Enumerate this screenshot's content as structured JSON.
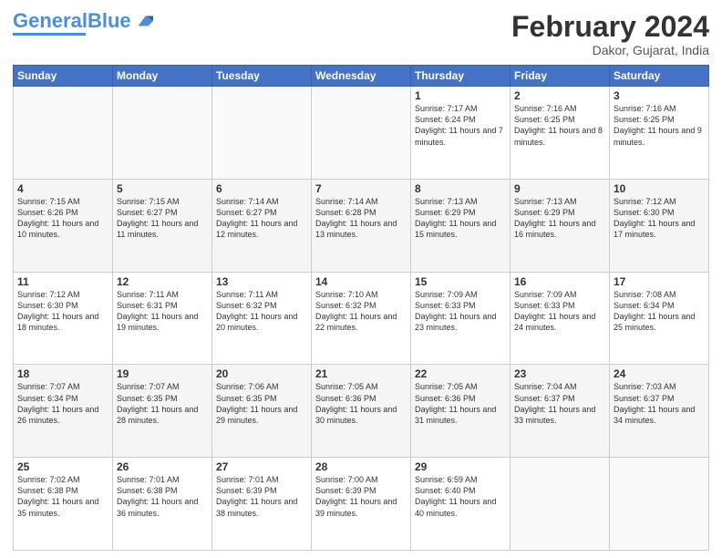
{
  "header": {
    "logo_general": "General",
    "logo_blue": "Blue",
    "month_title": "February 2024",
    "location": "Dakor, Gujarat, India"
  },
  "days_of_week": [
    "Sunday",
    "Monday",
    "Tuesday",
    "Wednesday",
    "Thursday",
    "Friday",
    "Saturday"
  ],
  "weeks": [
    [
      {
        "day": "",
        "sunrise": "",
        "sunset": "",
        "daylight": ""
      },
      {
        "day": "",
        "sunrise": "",
        "sunset": "",
        "daylight": ""
      },
      {
        "day": "",
        "sunrise": "",
        "sunset": "",
        "daylight": ""
      },
      {
        "day": "",
        "sunrise": "",
        "sunset": "",
        "daylight": ""
      },
      {
        "day": "1",
        "sunrise": "7:17 AM",
        "sunset": "6:24 PM",
        "daylight": "11 hours and 7 minutes."
      },
      {
        "day": "2",
        "sunrise": "7:16 AM",
        "sunset": "6:25 PM",
        "daylight": "11 hours and 8 minutes."
      },
      {
        "day": "3",
        "sunrise": "7:16 AM",
        "sunset": "6:25 PM",
        "daylight": "11 hours and 9 minutes."
      }
    ],
    [
      {
        "day": "4",
        "sunrise": "7:15 AM",
        "sunset": "6:26 PM",
        "daylight": "11 hours and 10 minutes."
      },
      {
        "day": "5",
        "sunrise": "7:15 AM",
        "sunset": "6:27 PM",
        "daylight": "11 hours and 11 minutes."
      },
      {
        "day": "6",
        "sunrise": "7:14 AM",
        "sunset": "6:27 PM",
        "daylight": "11 hours and 12 minutes."
      },
      {
        "day": "7",
        "sunrise": "7:14 AM",
        "sunset": "6:28 PM",
        "daylight": "11 hours and 13 minutes."
      },
      {
        "day": "8",
        "sunrise": "7:13 AM",
        "sunset": "6:29 PM",
        "daylight": "11 hours and 15 minutes."
      },
      {
        "day": "9",
        "sunrise": "7:13 AM",
        "sunset": "6:29 PM",
        "daylight": "11 hours and 16 minutes."
      },
      {
        "day": "10",
        "sunrise": "7:12 AM",
        "sunset": "6:30 PM",
        "daylight": "11 hours and 17 minutes."
      }
    ],
    [
      {
        "day": "11",
        "sunrise": "7:12 AM",
        "sunset": "6:30 PM",
        "daylight": "11 hours and 18 minutes."
      },
      {
        "day": "12",
        "sunrise": "7:11 AM",
        "sunset": "6:31 PM",
        "daylight": "11 hours and 19 minutes."
      },
      {
        "day": "13",
        "sunrise": "7:11 AM",
        "sunset": "6:32 PM",
        "daylight": "11 hours and 20 minutes."
      },
      {
        "day": "14",
        "sunrise": "7:10 AM",
        "sunset": "6:32 PM",
        "daylight": "11 hours and 22 minutes."
      },
      {
        "day": "15",
        "sunrise": "7:09 AM",
        "sunset": "6:33 PM",
        "daylight": "11 hours and 23 minutes."
      },
      {
        "day": "16",
        "sunrise": "7:09 AM",
        "sunset": "6:33 PM",
        "daylight": "11 hours and 24 minutes."
      },
      {
        "day": "17",
        "sunrise": "7:08 AM",
        "sunset": "6:34 PM",
        "daylight": "11 hours and 25 minutes."
      }
    ],
    [
      {
        "day": "18",
        "sunrise": "7:07 AM",
        "sunset": "6:34 PM",
        "daylight": "11 hours and 26 minutes."
      },
      {
        "day": "19",
        "sunrise": "7:07 AM",
        "sunset": "6:35 PM",
        "daylight": "11 hours and 28 minutes."
      },
      {
        "day": "20",
        "sunrise": "7:06 AM",
        "sunset": "6:35 PM",
        "daylight": "11 hours and 29 minutes."
      },
      {
        "day": "21",
        "sunrise": "7:05 AM",
        "sunset": "6:36 PM",
        "daylight": "11 hours and 30 minutes."
      },
      {
        "day": "22",
        "sunrise": "7:05 AM",
        "sunset": "6:36 PM",
        "daylight": "11 hours and 31 minutes."
      },
      {
        "day": "23",
        "sunrise": "7:04 AM",
        "sunset": "6:37 PM",
        "daylight": "11 hours and 33 minutes."
      },
      {
        "day": "24",
        "sunrise": "7:03 AM",
        "sunset": "6:37 PM",
        "daylight": "11 hours and 34 minutes."
      }
    ],
    [
      {
        "day": "25",
        "sunrise": "7:02 AM",
        "sunset": "6:38 PM",
        "daylight": "11 hours and 35 minutes."
      },
      {
        "day": "26",
        "sunrise": "7:01 AM",
        "sunset": "6:38 PM",
        "daylight": "11 hours and 36 minutes."
      },
      {
        "day": "27",
        "sunrise": "7:01 AM",
        "sunset": "6:39 PM",
        "daylight": "11 hours and 38 minutes."
      },
      {
        "day": "28",
        "sunrise": "7:00 AM",
        "sunset": "6:39 PM",
        "daylight": "11 hours and 39 minutes."
      },
      {
        "day": "29",
        "sunrise": "6:59 AM",
        "sunset": "6:40 PM",
        "daylight": "11 hours and 40 minutes."
      },
      {
        "day": "",
        "sunrise": "",
        "sunset": "",
        "daylight": ""
      },
      {
        "day": "",
        "sunrise": "",
        "sunset": "",
        "daylight": ""
      }
    ]
  ]
}
